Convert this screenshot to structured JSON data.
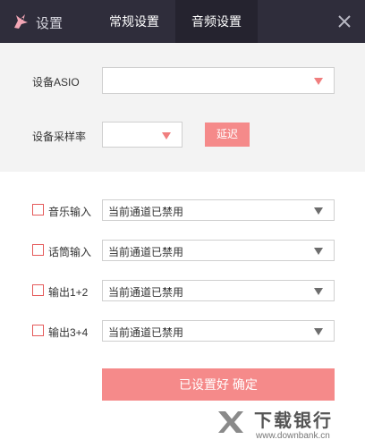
{
  "titlebar": {
    "app_title": "设置",
    "tabs": [
      {
        "label": "常规设置"
      },
      {
        "label": "音频设置"
      }
    ]
  },
  "device": {
    "asio_label": "设备ASIO",
    "asio_value": "",
    "sample_rate_label": "设备采样率",
    "sample_rate_value": "",
    "delay_button": "延迟"
  },
  "channels": [
    {
      "label": "音乐输入",
      "value": "当前通道已禁用",
      "checked": false
    },
    {
      "label": "话筒输入",
      "value": "当前通道已禁用",
      "checked": false
    },
    {
      "label": "输出1+2",
      "value": "当前通道已禁用",
      "checked": false
    },
    {
      "label": "输出3+4",
      "value": "当前通道已禁用",
      "checked": false
    }
  ],
  "confirm_button": "已设置好 确定",
  "watermark": {
    "text": "下载银行",
    "url": "www.downbank.cn"
  },
  "colors": {
    "titlebar": "#2f2d3b",
    "active_tab": "#25232f",
    "accent": "#f58a8a",
    "upper_panel": "#f3f3f3"
  },
  "icons": {
    "logo": "bird-logo-icon",
    "close": "close-icon",
    "dropdown_red": "triangle-down-icon",
    "dropdown_gray": "triangle-down-icon"
  }
}
